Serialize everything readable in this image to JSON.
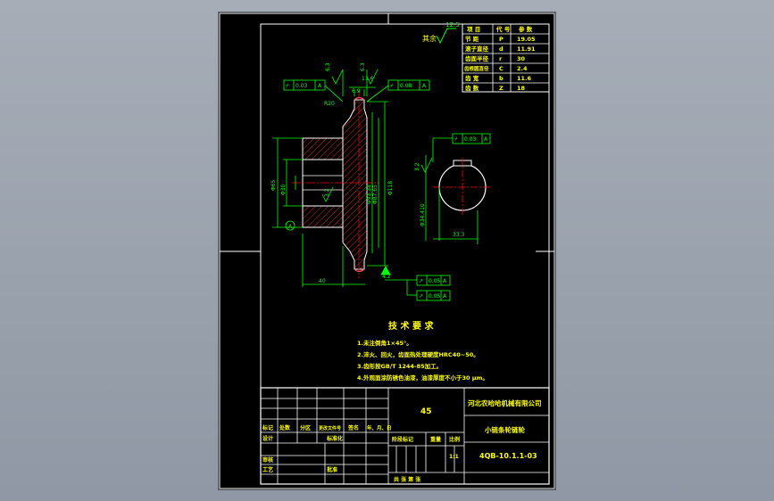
{
  "roughness_other": {
    "prefix": "其余",
    "value": "12.5"
  },
  "param_table": {
    "header": [
      "项 目",
      "代 号",
      "参 数"
    ],
    "rows": [
      [
        "节 距",
        "P",
        "19.05"
      ],
      [
        "滚子直径",
        "d",
        "11.91"
      ],
      [
        "齿面半径",
        "r",
        "30"
      ],
      [
        "齿根圆直径",
        "C",
        "2.4"
      ],
      [
        "齿 宽",
        "b",
        "11.6"
      ],
      [
        "齿 数",
        "Z",
        "18"
      ]
    ]
  },
  "dims": {
    "rough_top": "6.3",
    "rough_hub": "3.2",
    "rough_bore": "6.3",
    "rough_key": "3.2",
    "width_top": "11.6",
    "width_rim": "6.9",
    "tol_flat": "0.03",
    "tol_pos": "0.08",
    "tol_key": "0.03",
    "tol_run1": "0.05",
    "tol_run2": "0.05",
    "datum": "A",
    "angle": "R20",
    "chamfer": "4.2",
    "dia_hub": "Φ65",
    "dia_bore": "Φ30",
    "dia_pitch": "Φ93.38",
    "dia_root": "Φ87.65",
    "dia_tip": "Φ118",
    "dia_key": "Φ34.410",
    "key_width": "33.3",
    "hub_len": "40"
  },
  "tech_req": {
    "title": "技 术 要 求",
    "lines": [
      "1.未注倒角1×45°。",
      "2.淬火、回火，齿面热处理硬度HRC40~50。",
      "3.齿形按GB/T 1244-85加工。",
      "4.外观面涂防锈色油漆，油漆厚度不小于30 μm。"
    ]
  },
  "title_block": {
    "material": "45",
    "company": "河北农哈哈机械有限公司",
    "part_name": "小链条轮链轮",
    "drawing_no": "4QB-10.1.1-03",
    "scale": "1:1",
    "rev_row": [
      "标记",
      "处数",
      "分区",
      "更改文件号",
      "签名",
      "年、月、日"
    ],
    "stage_label": "阶段标记",
    "weight_label": "重量",
    "scale_label": "比例",
    "design": "设计",
    "standard": "标准化",
    "review": "审核",
    "process": "工艺",
    "approve": "批准",
    "sheets": "共  张  第  张"
  },
  "colors": {
    "background": "#000000",
    "border": "#ffffff",
    "geometry": "#ffffff",
    "dims": "#00ff00",
    "center": "#ff0000",
    "hatch": "#ff3333",
    "labels": "#ffff00"
  }
}
